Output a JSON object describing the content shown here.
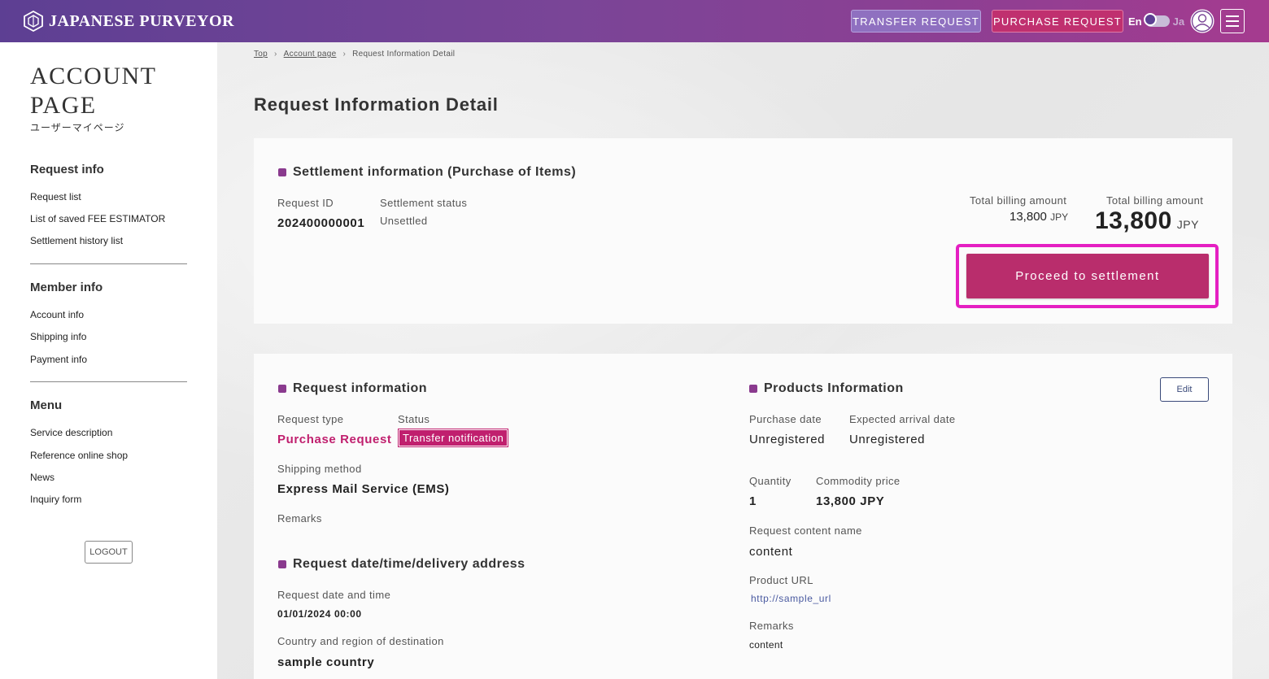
{
  "header": {
    "brand": "JAPANESE PURVEYOR",
    "transfer_request_label": "TRANSFER REQUEST",
    "purchase_request_label": "PURCHASE REQUEST",
    "lang_en": "En",
    "lang_ja": "Ja"
  },
  "sidebar": {
    "title_line1": "ACCOUNT",
    "title_line2": "PAGE",
    "subtitle": "ユーザーマイページ",
    "request_info": {
      "heading": "Request info",
      "items": [
        "Request list",
        "List of saved FEE ESTIMATOR",
        "Settlement history list"
      ]
    },
    "member_info": {
      "heading": "Member info",
      "items": [
        "Account info",
        "Shipping info",
        "Payment info"
      ]
    },
    "menu": {
      "heading": "Menu",
      "items": [
        "Service description",
        "Reference online shop",
        "News",
        "Inquiry form"
      ]
    },
    "logout_label": "LOGOUT"
  },
  "breadcrumb": {
    "items": [
      "Top",
      "Account page",
      "Request Information Detail"
    ]
  },
  "page_title": "Request Information Detail",
  "settlement": {
    "title": "Settlement information (Purchase of Items)",
    "request_id_label": "Request ID",
    "request_id": "202400000001",
    "status_label": "Settlement status",
    "status": "Unsettled",
    "total_label_1": "Total billing amount",
    "total_value_1": "13,800",
    "total_unit_1": "JPY",
    "total_label_2": "Total billing amount",
    "total_value_2": "13,800",
    "total_unit_2": "JPY",
    "proceed_label": "Proceed to settlement"
  },
  "request_info": {
    "title": "Request information",
    "type_label": "Request type",
    "type_value": "Purchase Request",
    "status_label": "Status",
    "status_value": "Transfer notification",
    "shipping_label": "Shipping method",
    "shipping_value": "Express Mail Service (EMS)",
    "remarks_label": "Remarks"
  },
  "request_date": {
    "title": "Request date/time/delivery address",
    "datetime_label": "Request date and time",
    "datetime_value": "01/01/2024 00:00",
    "country_label": "Country and region of destination",
    "country_value": "sample country"
  },
  "products": {
    "title": "Products Information",
    "edit_label": "Edit",
    "purchase_date_label": "Purchase date",
    "purchase_date_value": "Unregistered",
    "arrival_label": "Expected arrival date",
    "arrival_value": "Unregistered",
    "quantity_label": "Quantity",
    "quantity_value": "1",
    "price_label": "Commodity price",
    "price_value": "13,800 JPY",
    "content_name_label": "Request content name",
    "content_name_value": "content",
    "url_label": "Product URL",
    "url_value": "http://sample_url",
    "remarks_label": "Remarks",
    "remarks_value": "content"
  },
  "colors": {
    "accent": "#c01f6e",
    "header_start": "#5d3f93",
    "header_end": "#a53b8f",
    "highlight": "#e51fc2"
  },
  "icons": {
    "logo": "brand-cube-icon",
    "avatar": "user-avatar-icon",
    "menu": "hamburger-menu-icon",
    "breadcrumb_sep": "chevron-right-icon"
  }
}
